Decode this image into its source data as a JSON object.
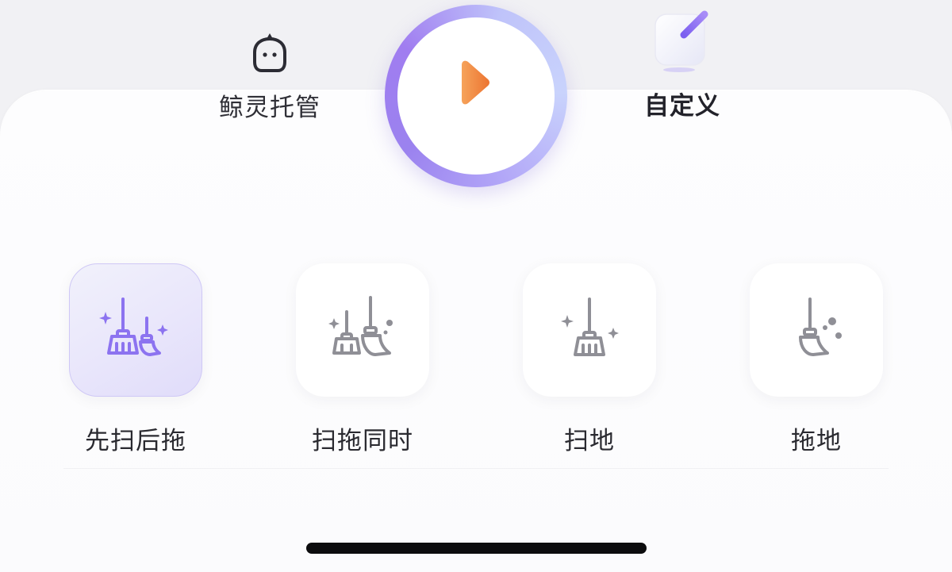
{
  "modes": {
    "ai": {
      "label": "鲸灵托管",
      "icon": "whale-spirit-icon"
    },
    "custom": {
      "label": "自定义",
      "icon": "edit-pen-icon",
      "selected": true
    }
  },
  "start_button": {
    "icon": "play-icon"
  },
  "clean_options": [
    {
      "label": "先扫后拖",
      "icon": "sweep-then-mop-icon",
      "selected": true
    },
    {
      "label": "扫拖同时",
      "icon": "sweep-and-mop-icon",
      "selected": false
    },
    {
      "label": "扫地",
      "icon": "sweep-icon",
      "selected": false
    },
    {
      "label": "拖地",
      "icon": "mop-icon",
      "selected": false
    }
  ],
  "colors": {
    "accent": "#8c73f0",
    "play": "#f08a3c",
    "icon_inactive": "#8f8f96"
  }
}
